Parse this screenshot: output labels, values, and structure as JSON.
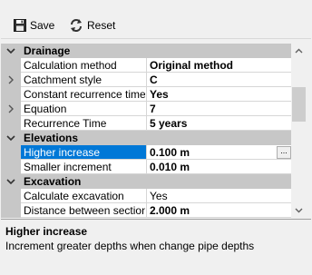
{
  "toolbar": {
    "save": {
      "label": "Save",
      "icon": "floppy-disk-icon"
    },
    "reset": {
      "label": "Reset",
      "icon": "reset-arrows-icon"
    }
  },
  "grid": {
    "categories": [
      {
        "title": "Drainage",
        "expanded": true,
        "properties": [
          {
            "name": "Calculation method",
            "value": "Original method",
            "bold": true,
            "expandable": false
          },
          {
            "name": "Catchment style",
            "value": "C",
            "bold": true,
            "expandable": true
          },
          {
            "name": "Constant recurrence time",
            "value": "Yes",
            "bold": true,
            "expandable": false
          },
          {
            "name": "Equation",
            "value": "7",
            "bold": true,
            "expandable": true
          },
          {
            "name": "Recurrence Time",
            "value": "5 years",
            "bold": true,
            "expandable": false
          }
        ]
      },
      {
        "title": "Elevations",
        "expanded": true,
        "properties": [
          {
            "name": "Higher increase",
            "value": "0.100 m",
            "bold": true,
            "selected": true,
            "ellipsis": "..."
          },
          {
            "name": "Smaller increment",
            "value": "0.010 m",
            "bold": true
          }
        ]
      },
      {
        "title": "Excavation",
        "expanded": true,
        "properties": [
          {
            "name": "Calculate excavation",
            "value": "Yes",
            "bold": false
          },
          {
            "name": "Distance between sections",
            "value": "2.000 m",
            "bold": true
          }
        ]
      }
    ]
  },
  "description": {
    "title": "Higher increase",
    "text": "Increment greater depths when change pipe depths"
  },
  "colors": {
    "selection": "#0078d7",
    "category_bg": "#c7c7c7",
    "window_bg": "#f0f0f0"
  }
}
